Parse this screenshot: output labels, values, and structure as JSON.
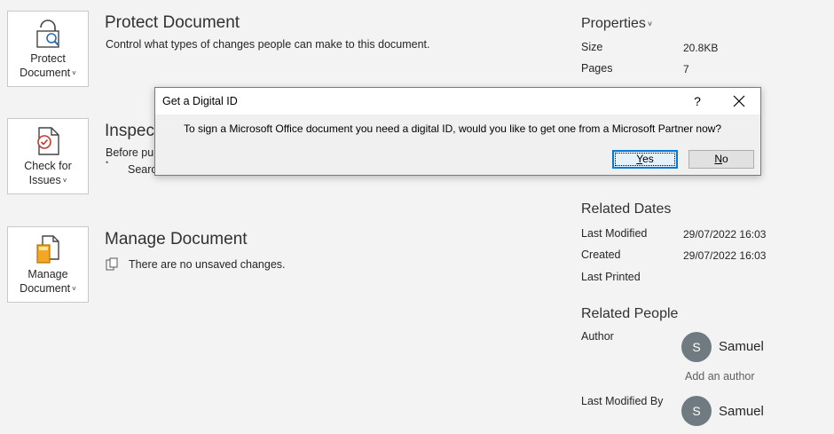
{
  "tiles": {
    "protect": {
      "label1": "Protect",
      "label2": "Document",
      "icon": "lock-document-icon"
    },
    "check": {
      "label1": "Check for",
      "label2": "Issues",
      "icon": "check-document-icon"
    },
    "manage": {
      "label1": "Manage",
      "label2": "Document",
      "icon": "manage-document-icon"
    },
    "chevron": "˅"
  },
  "sections": {
    "protect": {
      "title": "Protect Document",
      "text": "Control what types of changes people can make to this document."
    },
    "inspect": {
      "title": "Inspect",
      "text": "Before pub",
      "bullet": "Search"
    },
    "manage": {
      "title": "Manage Document",
      "text": "There are no unsaved changes."
    }
  },
  "properties": {
    "heading": "Properties",
    "rows": [
      {
        "label": "Size",
        "value": "20.8KB"
      },
      {
        "label": "Pages",
        "value": "7"
      }
    ]
  },
  "related_dates": {
    "heading": "Related Dates",
    "rows": [
      {
        "label": "Last Modified",
        "value": "29/07/2022 16:03"
      },
      {
        "label": "Created",
        "value": "29/07/2022 16:03"
      },
      {
        "label": "Last Printed",
        "value": ""
      }
    ]
  },
  "related_people": {
    "heading": "Related People",
    "author_label": "Author",
    "author": {
      "initial": "S",
      "name": "Samuel"
    },
    "add_author": "Add an author",
    "last_modified_label": "Last Modified By",
    "last_modified_by": {
      "initial": "S",
      "name": "Samuel"
    }
  },
  "dialog": {
    "title": "Get a Digital ID",
    "help": "?",
    "message": "To sign a Microsoft Office document you need a digital ID, would you like to get one from a Microsoft Partner now?",
    "yes_underlined": "Y",
    "yes_rest": "es",
    "no_underlined": "N",
    "no_rest": "o"
  },
  "colors": {
    "background": "#f3f3f3",
    "accent": "#0078d7",
    "avatar": "#6f7b80"
  }
}
